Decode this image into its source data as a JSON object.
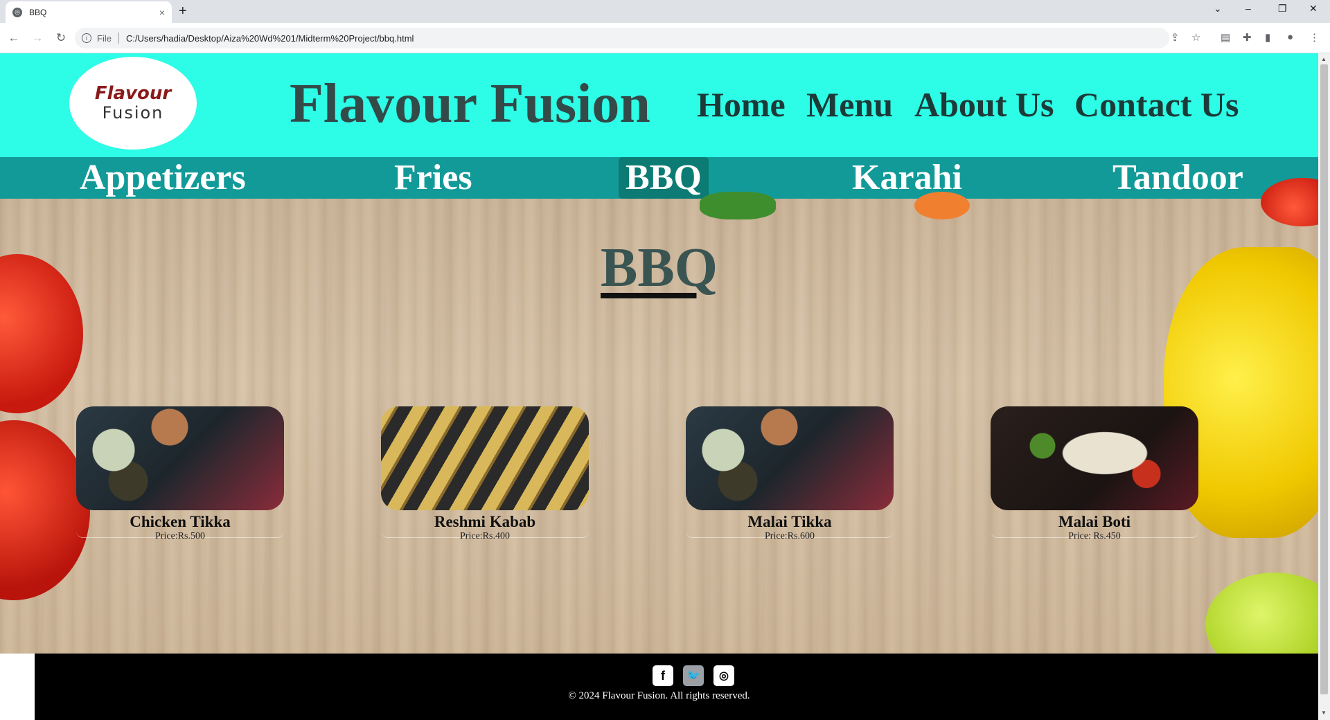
{
  "browser": {
    "tab_title": "BBQ",
    "tab_close": "×",
    "new_tab": "+",
    "address_prefix": "File",
    "url": "C:/Users/hadia/Desktop/Aiza%20Wd%201/Midterm%20Project/bbq.html",
    "win_min": "–",
    "win_restore": "❐",
    "win_close": "✕",
    "tab_search": "⌄"
  },
  "header": {
    "logo_line1": "Flavour",
    "logo_line2": "Fusion",
    "brand": "Flavour Fusion",
    "nav": [
      "Home",
      "Menu",
      "About Us",
      "Contact Us"
    ]
  },
  "categories": [
    "Appetizers",
    "Fries",
    "BBQ",
    "Karahi",
    "Tandoor"
  ],
  "active_category": "BBQ",
  "main": {
    "heading": "BBQ",
    "items": [
      {
        "name": "Chicken Tikka",
        "price": "Price:Rs.500"
      },
      {
        "name": "Reshmi Kabab",
        "price": "Price:Rs.400"
      },
      {
        "name": "Malai Tikka",
        "price": "Price:Rs.600"
      },
      {
        "name": "Malai Boti",
        "price": "Price: Rs.450"
      }
    ]
  },
  "footer": {
    "social": [
      "facebook-icon",
      "twitter-icon",
      "instagram-icon"
    ],
    "copyright": "© 2024 Flavour Fusion. All rights reserved."
  },
  "colors": {
    "header_bg": "#2dfce6",
    "category_bar": "#129a98",
    "active_category": "#0c7b74",
    "footer_bg": "#000000"
  }
}
